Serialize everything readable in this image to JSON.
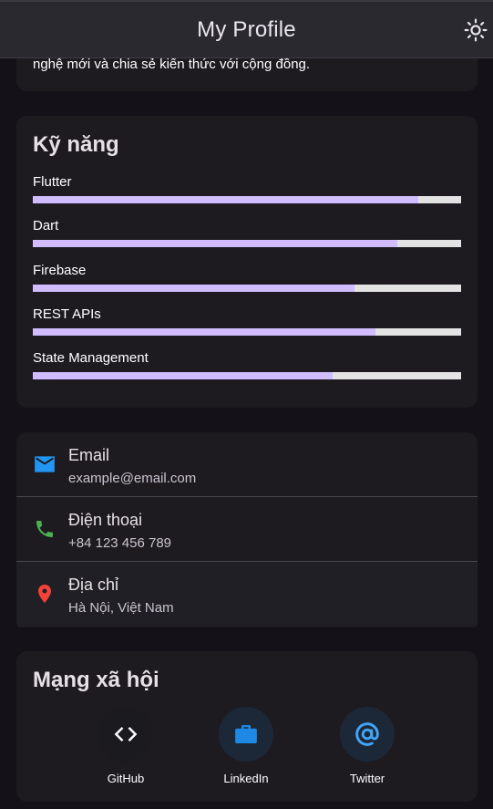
{
  "appbar": {
    "title": "My Profile",
    "theme_icon": "sun-icon"
  },
  "about": {
    "text_fragment": "nghệ mới và chia sẻ kiến thức với cộng đồng."
  },
  "skills": {
    "title": "Kỹ năng",
    "items": [
      {
        "label": "Flutter",
        "level": 0.9
      },
      {
        "label": "Dart",
        "level": 0.85
      },
      {
        "label": "Firebase",
        "level": 0.75
      },
      {
        "label": "REST APIs",
        "level": 0.8
      },
      {
        "label": "State Management",
        "level": 0.7
      }
    ],
    "fill_color": "#d0bcff",
    "track_color": "#e3e3e3"
  },
  "contact": {
    "items": [
      {
        "icon": "mail-icon",
        "label": "Email",
        "value": "example@email.com",
        "color": "#2196f3"
      },
      {
        "icon": "phone-icon",
        "label": "Điện thoại",
        "value": "+84 123 456 789",
        "color": "#4caf50"
      },
      {
        "icon": "location-pin-icon",
        "label": "Địa chỉ",
        "value": "Hà Nội, Việt Nam",
        "color": "#f44336"
      }
    ]
  },
  "social": {
    "title": "Mạng xã hội",
    "items": [
      {
        "icon": "code-icon",
        "label": "GitHub",
        "color": "#ffffff"
      },
      {
        "icon": "briefcase-icon",
        "label": "LinkedIn",
        "color": "#1e88e5"
      },
      {
        "icon": "at-sign-icon",
        "label": "Twitter",
        "color": "#42a5f5"
      }
    ]
  }
}
